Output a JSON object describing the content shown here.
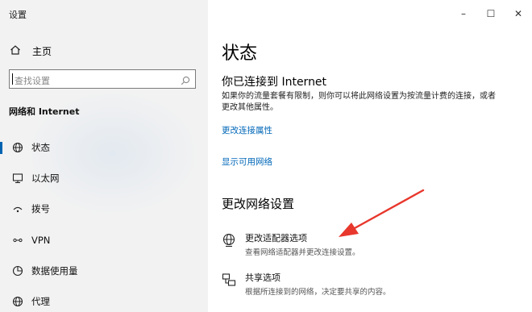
{
  "window": {
    "title": "设置",
    "controls": {
      "minimize": "–",
      "maximize": "☐",
      "close": "✕"
    }
  },
  "sidebar": {
    "home_label": "主页",
    "search_placeholder": "查找设置",
    "section_title": "网络和 Internet",
    "items": [
      {
        "label": "状态",
        "icon": "status-globe-icon",
        "selected": true
      },
      {
        "label": "以太网",
        "icon": "ethernet-icon",
        "selected": false
      },
      {
        "label": "拨号",
        "icon": "dialup-icon",
        "selected": false
      },
      {
        "label": "VPN",
        "icon": "vpn-icon",
        "selected": false
      },
      {
        "label": "数据使用量",
        "icon": "data-usage-icon",
        "selected": false
      },
      {
        "label": "代理",
        "icon": "proxy-globe-icon",
        "selected": false
      }
    ],
    "accent_color": "#0063b1"
  },
  "main": {
    "title": "状态",
    "connection_title": "你已连接到 Internet",
    "connection_desc": "如果你的流量套餐有限制，则你可以将此网络设置为按流量计费的连接，或者更改其他属性。",
    "links": {
      "change_props": "更改连接属性",
      "show_networks": "显示可用网络"
    },
    "change_section_title": "更改网络设置",
    "options": [
      {
        "title": "更改适配器选项",
        "desc": "查看网络适配器并更改连接设置。",
        "icon": "adapter-globe-icon"
      },
      {
        "title": "共享选项",
        "desc": "根据所连接到的网络，决定要共享的内容。",
        "icon": "sharing-icon"
      }
    ],
    "link_color": "#0067b8",
    "annotation_arrow_color": "#e8372c"
  }
}
